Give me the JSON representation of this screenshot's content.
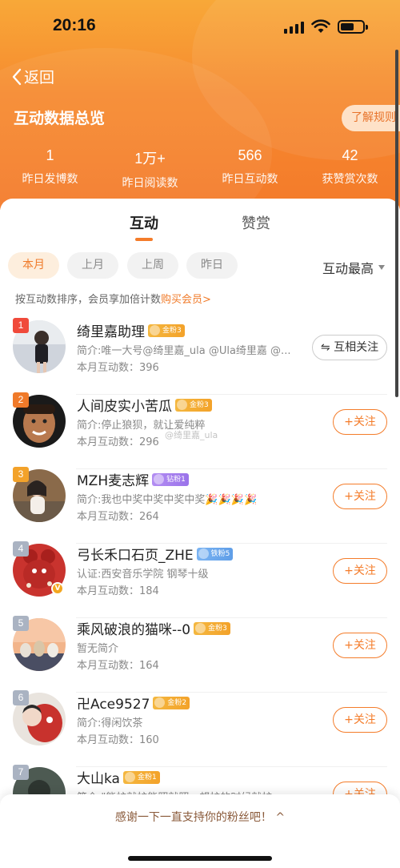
{
  "status_bar": {
    "time": "20:16"
  },
  "nav": {
    "back_label": "返回"
  },
  "header": {
    "title": "互动数据总览",
    "rules_button": "了解规则"
  },
  "stats": [
    {
      "value": "1",
      "label": "昨日发博数"
    },
    {
      "value": "1万+",
      "label": "昨日阅读数"
    },
    {
      "value": "566",
      "label": "昨日互动数"
    },
    {
      "value": "42",
      "label": "获赞赏次数"
    }
  ],
  "tabs": [
    {
      "label": "互动",
      "active": true
    },
    {
      "label": "赞赏",
      "active": false
    }
  ],
  "filters": [
    {
      "label": "本月",
      "active": true
    },
    {
      "label": "上月",
      "active": false
    },
    {
      "label": "上周",
      "active": false
    },
    {
      "label": "昨日",
      "active": false
    }
  ],
  "sort": {
    "label": "互动最高"
  },
  "note": {
    "text": "按互动数排序，会员享加倍计数",
    "link": "购买会员>"
  },
  "fans": [
    {
      "rank": "1",
      "name": "绮里嘉助理",
      "badge": "金粉3",
      "badge_type": "gold",
      "bio": "简介:唯一大号@绮里嘉_ula @Ula绮里嘉 @...",
      "count": "本月互动数：396",
      "button": "⇋ 互相关注",
      "button_type": "mutual",
      "rank_color": "#f04a3b"
    },
    {
      "rank": "2",
      "name": "人间皮实小苦瓜",
      "badge": "金粉3",
      "badge_type": "gold",
      "bio": "简介:停止狼狈，就让爱纯粹",
      "count": "本月互动数：296",
      "button": "+关注",
      "button_type": "follow",
      "rank_color": "#f07a2a"
    },
    {
      "rank": "3",
      "name": "MZH麦志辉",
      "badge": "钻粉1",
      "badge_type": "silver",
      "bio": "简介:我也中奖中奖中奖中奖🎉🎉🎉🎉",
      "count": "本月互动数：264",
      "button": "+关注",
      "button_type": "follow",
      "rank_color": "#f3a22a"
    },
    {
      "rank": "4",
      "name": "弓长禾口石页_ZHE",
      "badge": "铁粉5",
      "badge_type": "iron",
      "bio": "认证:西安音乐学院 钢琴十级",
      "count": "本月互动数：184",
      "button": "+关注",
      "button_type": "follow",
      "rank_color": "#aab3c2"
    },
    {
      "rank": "5",
      "name": "乘风破浪的猫咪--0",
      "badge": "金粉3",
      "badge_type": "gold",
      "bio": "暂无简介",
      "count": "本月互动数：164",
      "button": "+关注",
      "button_type": "follow",
      "rank_color": "#aab3c2"
    },
    {
      "rank": "6",
      "name": "卍Ace9527",
      "badge": "金粉2",
      "badge_type": "gold",
      "bio": "简介:得闲饮茶",
      "count": "本月互动数：160",
      "button": "+关注",
      "button_type": "follow",
      "rank_color": "#aab3c2"
    },
    {
      "rank": "7",
      "name": "大山ka",
      "badge": "金粉1",
      "badge_type": "gold",
      "bio": "简介:\"能护就护能照就照，想护的时候就护。用...",
      "count": "",
      "button": "+关注",
      "button_type": "follow",
      "rank_color": "#aab3c2"
    }
  ],
  "watermark": "@绮里嘉_ula",
  "footer": {
    "text": "感谢一下一直支持你的粉丝吧！ ^"
  },
  "colors": {
    "accent": "#f47c2a",
    "header_top": "#f8a838",
    "header_bottom": "#f47a2a"
  }
}
